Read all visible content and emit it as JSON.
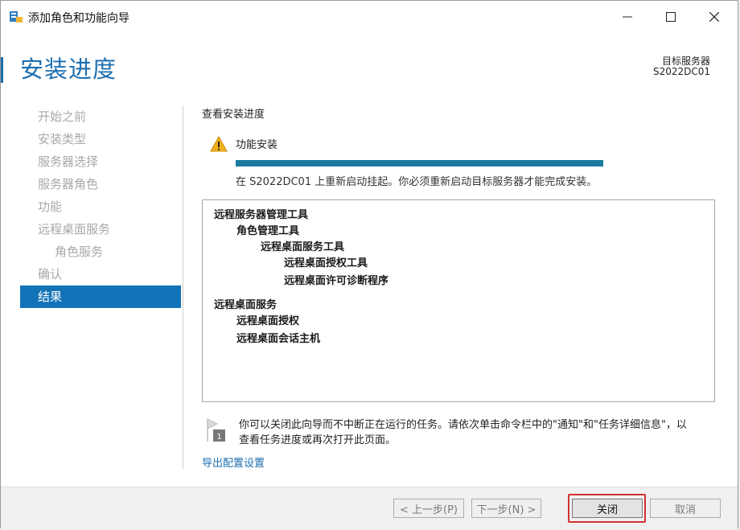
{
  "window": {
    "title": "添加角色和功能向导"
  },
  "header": {
    "page_title": "安装进度",
    "target_label": "目标服务器",
    "target_name": "S2022DC01"
  },
  "nav": {
    "items": [
      {
        "label": "开始之前"
      },
      {
        "label": "安装类型"
      },
      {
        "label": "服务器选择"
      },
      {
        "label": "服务器角色"
      },
      {
        "label": "功能"
      },
      {
        "label": "远程桌面服务"
      },
      {
        "label": "角色服务"
      },
      {
        "label": "确认"
      },
      {
        "label": "结果"
      }
    ],
    "active": "结果"
  },
  "content": {
    "section_title": "查看安装进度",
    "feature_install_label": "功能安装",
    "progress_percent": 100,
    "status_text": "在 S2022DC01 上重新启动挂起。你必须重新启动目标服务器才能完成安装。",
    "list": [
      {
        "text": "远程服务器管理工具",
        "level": 0
      },
      {
        "text": "角色管理工具",
        "level": 1
      },
      {
        "text": "远程桌面服务工具",
        "level": 2
      },
      {
        "text": "远程桌面授权工具",
        "level": 3
      },
      {
        "text": "远程桌面许可诊断程序",
        "level": 3
      },
      {
        "text": "远程桌面服务",
        "level": 0
      },
      {
        "text": "远程桌面授权",
        "level": 1
      },
      {
        "text": "远程桌面会话主机",
        "level": 1
      }
    ],
    "note_badge": "1",
    "note_line1": "你可以关闭此向导而不中断正在运行的任务。请依次单击命令栏中的\"通知\"和\"任务详细信息\"，以",
    "note_line2": "查看任务进度或再次打开此页面。",
    "export_link": "导出配置设置"
  },
  "footer": {
    "prev_label": "< 上一步(P)",
    "next_label": "下一步(N) >",
    "close_label": "关闭",
    "cancel_label": "取消"
  },
  "colors": {
    "accent": "#1d6fb0",
    "active_nav": "#1373b8",
    "progress": "#1a7aa0",
    "highlight": "#d13232"
  }
}
